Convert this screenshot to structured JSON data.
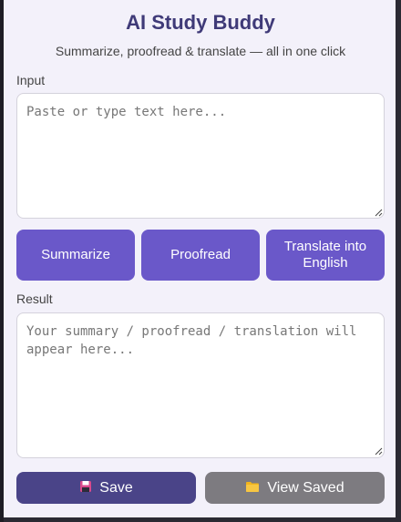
{
  "app": {
    "title": "AI Study Buddy",
    "subtitle": "Summarize, proofread & translate — all in one click"
  },
  "input": {
    "label": "Input",
    "placeholder": "Paste or type text here..."
  },
  "actions": {
    "summarize_label": "Summarize",
    "proofread_label": "Proofread",
    "translate_label": "Translate into English"
  },
  "result": {
    "label": "Result",
    "placeholder": "Your summary / proofread / translation will appear here..."
  },
  "footer": {
    "save_label": "Save",
    "save_icon": "floppy-disk-icon",
    "view_saved_label": "View Saved",
    "view_saved_icon": "folder-icon"
  },
  "colors": {
    "title": "#3f3a78",
    "action_button": "#6a58c9",
    "save_button": "#4a4488",
    "view_saved_button": "#7d7b80",
    "panel_background": "#f3f1fa"
  }
}
